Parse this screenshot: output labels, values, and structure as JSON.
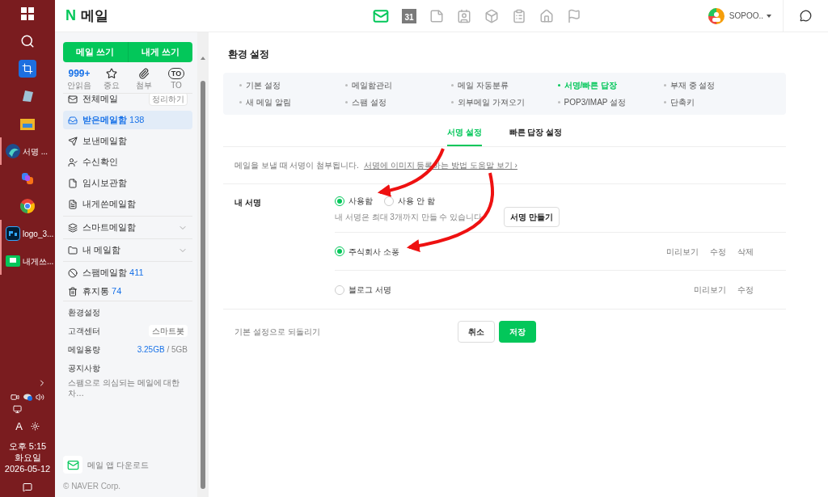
{
  "taskbar": {
    "apps": [
      {
        "kind": "windows"
      },
      {
        "kind": "search"
      },
      {
        "kind": "crop"
      },
      {
        "kind": "glass"
      },
      {
        "kind": "folder"
      },
      {
        "kind": "app",
        "label": "서명 ...",
        "running": true
      },
      {
        "kind": "copilot"
      },
      {
        "kind": "chrome"
      },
      {
        "kind": "ps",
        "label": "logo_3...",
        "running": true
      },
      {
        "kind": "mail",
        "label": "내게쓰...",
        "running": true
      }
    ],
    "tray": {
      "time": "오후 5:15",
      "day": "화요일",
      "date": "2026-05-12",
      "ime": "A"
    }
  },
  "header": {
    "logo": "N",
    "title": "메일",
    "calendar_day": "31",
    "nav": [
      {
        "kind": "mail",
        "selected": true
      },
      {
        "kind": "calendar",
        "selected": false
      },
      {
        "kind": "note",
        "selected": false
      },
      {
        "kind": "contacts",
        "selected": false
      },
      {
        "kind": "box",
        "selected": false
      },
      {
        "kind": "tasks",
        "selected": false
      },
      {
        "kind": "home",
        "selected": false
      },
      {
        "kind": "flag",
        "selected": false
      }
    ],
    "user": "SOPOO.."
  },
  "sidebar": {
    "buttons": [
      "메일 쓰기",
      "내게 쓰기"
    ],
    "quick": [
      {
        "kind": "count",
        "value": "999+",
        "label": "안읽음"
      },
      {
        "kind": "star",
        "label": "중요"
      },
      {
        "kind": "clip",
        "label": "첨부"
      },
      {
        "kind": "to",
        "value": "TO",
        "label": "TO"
      }
    ],
    "folders": [
      {
        "kind": "all",
        "label": "전체메일",
        "action": "정리하기",
        "selected": false
      },
      {
        "kind": "inbox",
        "label": "받은메일함",
        "count": "138",
        "selected": true
      },
      {
        "kind": "sent",
        "label": "보낸메일함",
        "selected": false
      },
      {
        "kind": "receipt",
        "label": "수신확인",
        "selected": false
      },
      {
        "kind": "draft",
        "label": "임시보관함",
        "selected": false
      },
      {
        "kind": "self",
        "label": "내게쓴메일함",
        "selected": false
      }
    ],
    "groups": [
      {
        "kind": "smart",
        "label": "스마트메일함",
        "expanded": false
      },
      {
        "kind": "mine",
        "label": "내 메일함",
        "expanded": false
      }
    ],
    "special": [
      {
        "kind": "spam",
        "label": "스팸메일함",
        "count": "411"
      },
      {
        "kind": "trash",
        "label": "휴지통",
        "count": "74"
      }
    ],
    "links": [
      {
        "kind": "plain",
        "label": "환경설정"
      },
      {
        "kind": "badge",
        "label": "고객센터",
        "badge": "스마트봇"
      },
      {
        "kind": "usage",
        "label": "메일용량",
        "used": "3.25GB",
        "total": "/ 5GB"
      },
      {
        "kind": "plain",
        "label": "공지사항"
      }
    ],
    "notice": "스팸으로 의심되는 메일에 대한 차…",
    "download": "메일 앱 다운로드",
    "copyright": "© NAVER Corp."
  },
  "main": {
    "title": "환경 설정",
    "menu": [
      {
        "label": "기본 설정",
        "selected": false
      },
      {
        "label": "메일함관리",
        "selected": false
      },
      {
        "label": "메일 자동분류",
        "selected": false
      },
      {
        "label": "서명/빠른 답장",
        "selected": true
      },
      {
        "label": "부재 중 설정",
        "selected": false
      },
      {
        "label": "새 메일 알림",
        "selected": false
      },
      {
        "label": "스팸 설정",
        "selected": false
      },
      {
        "label": "외부메일 가져오기",
        "selected": false
      },
      {
        "label": "POP3/IMAP 설정",
        "selected": false
      },
      {
        "label": "단축키",
        "selected": false
      }
    ],
    "tabs": [
      {
        "label": "서명 설정",
        "selected": true
      },
      {
        "label": "빠른 답장 설정",
        "selected": false
      }
    ],
    "description": "메일을 보낼 때 서명이 첨부됩니다.",
    "help_link": "서명에 이미지 등록하는 방법 도움말 보기 ›",
    "signature": {
      "label": "내 서명",
      "options": [
        {
          "label": "사용함",
          "selected": true
        },
        {
          "label": "사용 안 함",
          "selected": false
        }
      ],
      "hint": "내 서명은 최대 3개까지 만들 수 있습니다.",
      "create_button": "서명 만들기",
      "items": [
        {
          "name": "주식회사 소퐁",
          "selected": true,
          "actions": [
            "미리보기",
            "수정",
            "삭제"
          ]
        },
        {
          "name": "블로그 서명",
          "selected": false,
          "actions": [
            "미리보기",
            "수정"
          ]
        }
      ]
    },
    "reset": "기본 설정으로 되돌리기",
    "buttons": [
      {
        "kind": "cancel",
        "label": "취소"
      },
      {
        "kind": "save",
        "label": "저장"
      }
    ]
  }
}
